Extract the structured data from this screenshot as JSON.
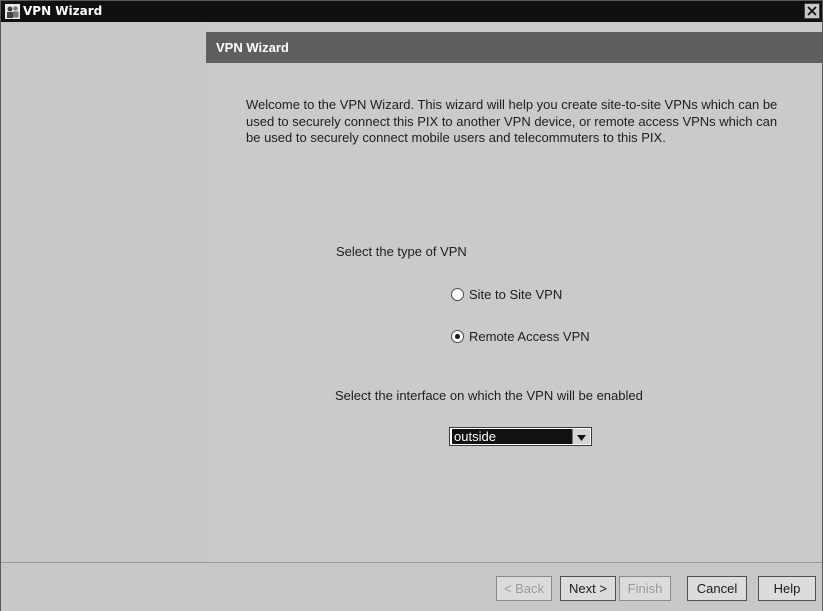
{
  "window": {
    "title": "VPN Wizard",
    "app_icon": "people-icon",
    "close_icon": "close-icon"
  },
  "content": {
    "header_title": "VPN Wizard",
    "intro": "Welcome to the VPN Wizard. This wizard will help you create site-to-site VPNs which can be used to securely connect this PIX to another VPN device, or remote access VPNs which can be used to securely connect mobile users and telecommuters to this PIX.",
    "vpn_type_label": "Select the type of VPN",
    "vpn_options": [
      {
        "label": "Site to Site VPN",
        "selected": false
      },
      {
        "label": "Remote Access VPN",
        "selected": true
      }
    ],
    "interface_label": "Select the interface on which the VPN will be enabled",
    "interface_select": {
      "value": "outside",
      "arrow_icon": "chevron-down-icon"
    }
  },
  "footer": {
    "buttons": {
      "back": {
        "label": "< Back",
        "enabled": false
      },
      "next": {
        "label": "Next >",
        "enabled": true
      },
      "finish": {
        "label": "Finish",
        "enabled": false
      },
      "cancel": {
        "label": "Cancel",
        "enabled": true
      },
      "help": {
        "label": "Help",
        "enabled": true
      }
    }
  }
}
